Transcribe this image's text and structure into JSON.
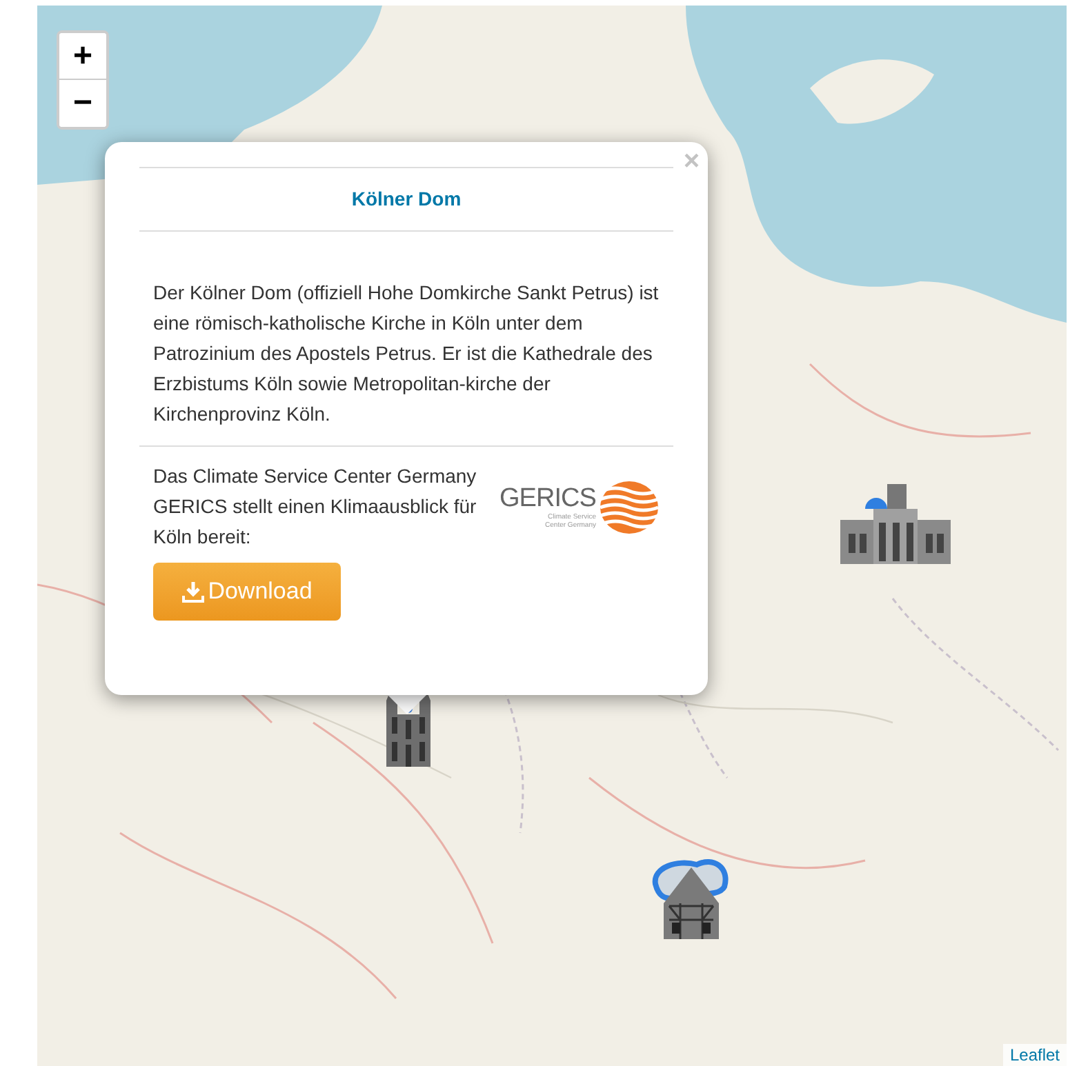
{
  "map": {
    "zoom_controls": [
      {
        "label": "+"
      },
      {
        "label": "−"
      }
    ],
    "markers": [
      {
        "kind": "cathedral"
      },
      {
        "kind": "hall"
      },
      {
        "kind": "timber-house"
      }
    ],
    "attribution": "Leaflet"
  },
  "popup": {
    "close": "×",
    "title": "Kölner Dom",
    "description": "Der Kölner Dom (offiziell Hohe Domkirche Sankt Petrus) ist eine römisch-katholische Kirche in Köln unter dem Patrozinium des Apostels Petrus. Er ist die Kathedrale des Erzbistums Köln sowie Metropolitan-kirche der Kirchenprovinz Köln.",
    "climate_text": "Das Climate Service Center Germany GERICS stellt einen Klimaausblick für Köln bereit:",
    "logo": {
      "name": "GERICS",
      "subtitle": "Climate Service Center Germany"
    },
    "button": {
      "label": "Download"
    }
  }
}
